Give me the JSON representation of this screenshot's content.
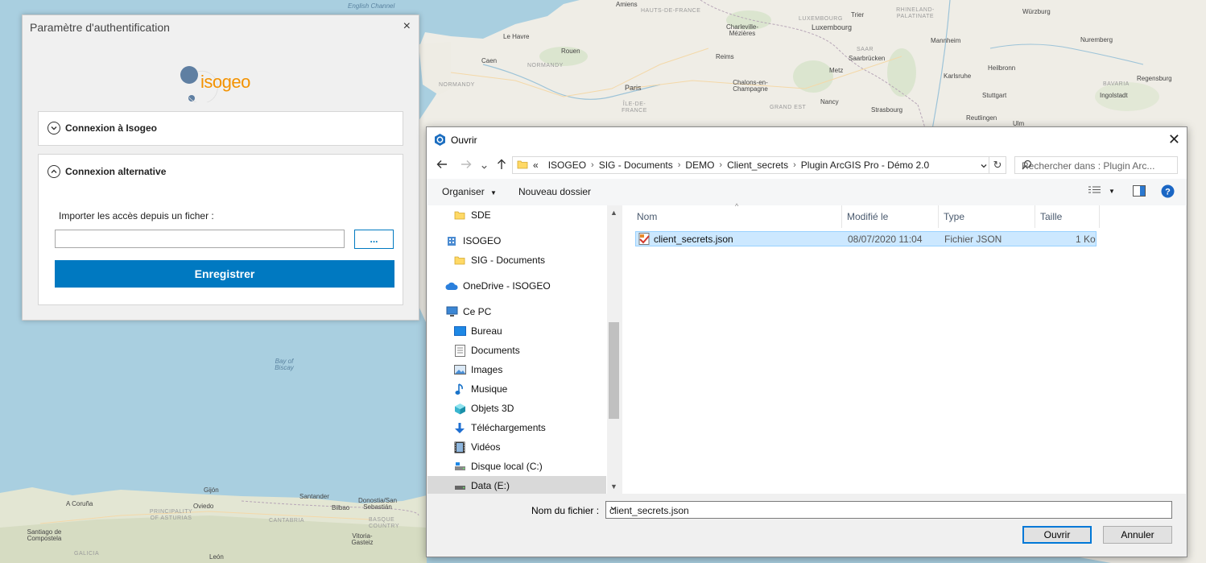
{
  "map": {
    "labels": {
      "english_channel": "English Channel",
      "bay_of_biscay": "Bay of Biscay",
      "amiens": "Amiens",
      "hauts_de_france": "HAUTS-DE-FRANCE",
      "charleville": "Charleville-Mézières",
      "luxembourg_country": "LUXEMBOURG",
      "luxembourg_city": "Luxembourg",
      "trier": "Trier",
      "rhineland": "RHINELAND-PALATINATE",
      "wurzburg": "Würzburg",
      "le_havre": "Le Havre",
      "rouen": "Rouen",
      "normandy1": "NORMANDY",
      "normandy2": "NORMANDY",
      "caen": "Caen",
      "reims": "Reims",
      "metz": "Metz",
      "saarbrucken": "Saarbrücken",
      "saar": "SAAR",
      "mannheim": "Mannheim",
      "nuremberg": "Nuremberg",
      "heilbronn": "Heilbronn",
      "karlsruhe": "Karlsruhe",
      "paris": "Paris",
      "ile_de_france": "ÎLE-DE-FRANCE",
      "chalons": "Chalons-en-Champagne",
      "grand_est": "GRAND EST",
      "nancy": "Nancy",
      "strasbourg": "Strasbourg",
      "stuttgart": "Stuttgart",
      "bavaria": "BAVARIA",
      "regensburg": "Regensburg",
      "ingolstadt": "Ingolstadt",
      "reutlingen": "Reutlingen",
      "ulm": "Ulm",
      "gijon": "Gijón",
      "santander": "Santander",
      "donostia": "Donostia/San Sebastián",
      "oviedo": "Oviedo",
      "bilbao": "Bilbao",
      "a_coruna": "A Coruña",
      "asturias": "PRINCIPALITY OF ASTURIAS",
      "cantabria": "CANTABRIA",
      "basque": "BASQUE COUNTRY",
      "santiago": "Santiago de Compostela",
      "galicia": "GALICIA",
      "leon": "León",
      "vitoria": "Vitoria-Gasteiz"
    }
  },
  "auth_dialog": {
    "title": "Paramètre d'authentification",
    "close": "×",
    "logo_text": "isogeo",
    "panel_main": {
      "label": "Connexion à Isogeo"
    },
    "panel_alt": {
      "label": "Connexion alternative",
      "import_label": "Importer les accès depuis un ficher :",
      "file_value": "",
      "browse_label": "...",
      "save_label": "Enregistrer"
    }
  },
  "open_dialog": {
    "title": "Ouvrir",
    "close": "✕",
    "breadcrumb": [
      "«",
      "ISOGEO",
      "SIG - Documents",
      "DEMO",
      "Client_secrets",
      "Plugin ArcGIS Pro - Démo 2.0"
    ],
    "search_placeholder": "Rechercher dans : Plugin Arc...",
    "toolbar": {
      "organize": "Organiser",
      "new_folder": "Nouveau dossier"
    },
    "tree": [
      {
        "label": "SDE",
        "icon": "folder-icon"
      },
      {
        "label": "ISOGEO",
        "icon": "building-icon"
      },
      {
        "label": "SIG - Documents",
        "icon": "folder-icon"
      },
      {
        "label": "OneDrive - ISOGEO",
        "icon": "cloud-icon"
      },
      {
        "label": "Ce PC",
        "icon": "computer-icon"
      },
      {
        "label": "Bureau",
        "icon": "desktop-icon"
      },
      {
        "label": "Documents",
        "icon": "documents-icon"
      },
      {
        "label": "Images",
        "icon": "images-icon"
      },
      {
        "label": "Musique",
        "icon": "music-icon"
      },
      {
        "label": "Objets 3D",
        "icon": "cube-icon"
      },
      {
        "label": "Téléchargements",
        "icon": "download-icon"
      },
      {
        "label": "Vidéos",
        "icon": "video-icon"
      },
      {
        "label": "Disque local (C:)",
        "icon": "drive-icon"
      },
      {
        "label": "Data (E:)",
        "icon": "drive-icon",
        "selected": true
      }
    ],
    "columns": {
      "name": "Nom",
      "modified": "Modifié le",
      "type": "Type",
      "size": "Taille"
    },
    "files": [
      {
        "name": "client_secrets.json",
        "modified": "08/07/2020 11:04",
        "type": "Fichier JSON",
        "size": "1 Ko"
      }
    ],
    "filename_label": "Nom du fichier :",
    "filename_value": "client_secrets.json",
    "open_label": "Ouvrir",
    "cancel_label": "Annuler"
  },
  "colors": {
    "accent": "#0079c1",
    "selection": "#cce8ff",
    "sea": "#a9cfe0",
    "land": "#efede6"
  }
}
